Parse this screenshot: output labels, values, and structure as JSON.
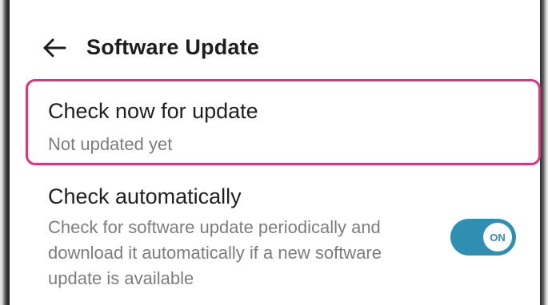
{
  "header": {
    "back_icon": "arrow-left-icon",
    "title": "Software Update"
  },
  "items": [
    {
      "title": "Check now for update",
      "subtitle": "Not updated yet",
      "highlighted": true,
      "highlight_color": "#e0307e"
    },
    {
      "title": "Check automatically",
      "subtitle": "Check for software update periodically and download it automatically if a new software update is available",
      "toggle": {
        "state": true,
        "label": "ON",
        "color": "#2f8fb3"
      }
    }
  ]
}
